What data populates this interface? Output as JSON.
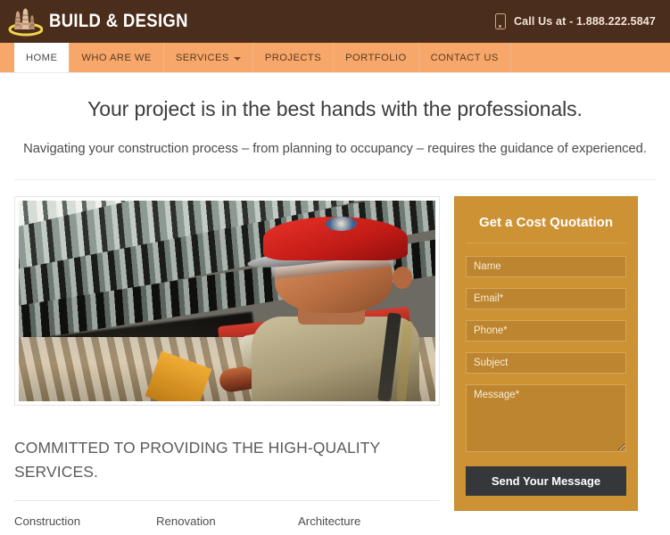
{
  "header": {
    "logo_text": "BUILD & DESIGN",
    "logo_icon": "building-logo-icon",
    "phone_icon": "phone-icon",
    "call_text": "Call Us at - 1.888.222.5847"
  },
  "nav": {
    "items": [
      {
        "label": "HOME",
        "active": true,
        "has_dropdown": false
      },
      {
        "label": "WHO ARE WE",
        "active": false,
        "has_dropdown": false
      },
      {
        "label": "SERVICES",
        "active": false,
        "has_dropdown": true
      },
      {
        "label": "PROJECTS",
        "active": false,
        "has_dropdown": false
      },
      {
        "label": "PORTFOLIO",
        "active": false,
        "has_dropdown": false
      },
      {
        "label": "CONTACT US",
        "active": false,
        "has_dropdown": false
      }
    ]
  },
  "hero": {
    "heading": "Your project is in the best hands with the professionals.",
    "subheading": "Navigating your construction process – from planning to occupancy – requires the guidance of experienced."
  },
  "main": {
    "photo_alt": "construction-worker-photo",
    "section_title": "COMMITTED TO PROVIDING THE HIGH-QUALITY SERVICES.",
    "services": [
      "Construction",
      "Renovation",
      "Architecture"
    ]
  },
  "quote_form": {
    "title": "Get a Cost Quotation",
    "fields": [
      {
        "name": "name",
        "placeholder": "Name"
      },
      {
        "name": "email",
        "placeholder": "Email*"
      },
      {
        "name": "phone",
        "placeholder": "Phone*"
      },
      {
        "name": "subject",
        "placeholder": "Subject"
      }
    ],
    "message_placeholder": "Message*",
    "submit_label": "Send Your Message"
  },
  "colors": {
    "header_bg": "#4a2d1b",
    "nav_bg": "#f7a769",
    "form_bg": "#cc9233",
    "button_bg": "#36373a",
    "accent": "#cc9233"
  }
}
